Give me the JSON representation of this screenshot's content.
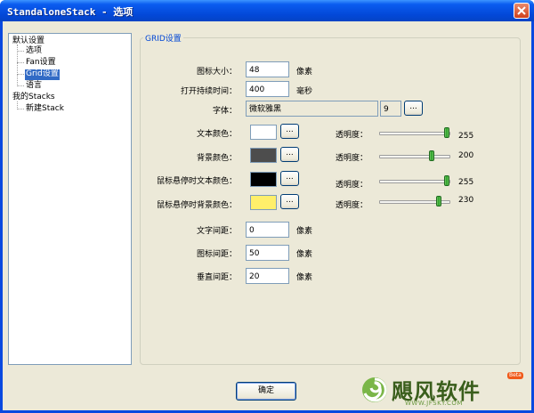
{
  "window": {
    "title": "StandaloneStack - 选项"
  },
  "tree": {
    "items": [
      {
        "label": "默认设置"
      },
      {
        "label": "选项"
      },
      {
        "label": "Fan设置"
      },
      {
        "label": "Grid设置"
      },
      {
        "label": "语言"
      },
      {
        "label": "我的Stacks"
      },
      {
        "label": "新建Stack"
      }
    ]
  },
  "grid": {
    "group_title": "GRID设置",
    "icon_size": {
      "label": "图标大小：",
      "value": "48",
      "unit": "像素"
    },
    "hover_time": {
      "label": "打开持续时间：",
      "value": "400",
      "unit": "毫秒"
    },
    "font": {
      "label": "字体：",
      "value": "微软雅黑",
      "size": "9",
      "button": "..."
    },
    "text_color": {
      "label": "文本颜色：",
      "color": "#ffffff",
      "button": "...",
      "opacity_label": "透明度：",
      "opacity": 255
    },
    "bg_color": {
      "label": "背景颜色：",
      "color": "#4d4d4d",
      "button": "...",
      "opacity_label": "透明度：",
      "opacity": 200
    },
    "hover_text_color": {
      "label": "鼠标悬停时文本颜色：",
      "color": "#000000",
      "button": "...",
      "opacity_label": "透明度：",
      "opacity": 255
    },
    "hover_bg_color": {
      "label": "鼠标悬停时背景颜色：",
      "color": "#ffef6a",
      "button": "...",
      "opacity_label": "透明度：",
      "opacity": 230
    },
    "text_spacing": {
      "label": "文字间距：",
      "value": "0",
      "unit": "像素"
    },
    "icon_spacing": {
      "label": "图标间距：",
      "value": "50",
      "unit": "像素"
    },
    "vertical_spacing": {
      "label": "垂直间距：",
      "value": "20",
      "unit": "像素"
    }
  },
  "footer": {
    "ok_label": "确定"
  },
  "watermark": {
    "brand": "飓风软件",
    "url": "WWW.JFSKY.COM",
    "badge": "Beta"
  }
}
